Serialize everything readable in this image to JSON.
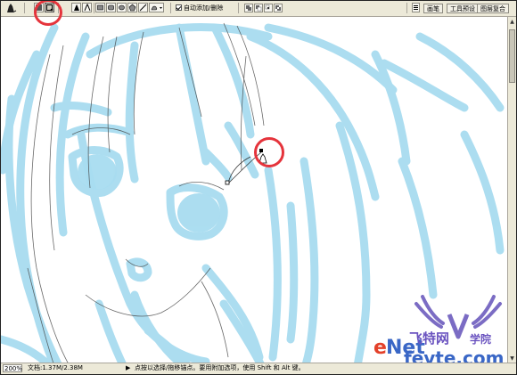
{
  "options_bar": {
    "auto_add_delete_label": "自动添加/删除",
    "auto_add_delete_checked": true,
    "palette_tabs": [
      "画笔",
      "工具预设",
      "图层复合"
    ]
  },
  "status_bar": {
    "zoom": "200%",
    "doc_info": "文档:1.37M/2.38M",
    "hint": "点按以选择/拖移锚点。要用附加选项，使用 Shift 和 Alt 键。"
  },
  "watermark": {
    "site_chinese": "飞特网",
    "site_chinese_suffix": "学院",
    "domain": "fevte.com",
    "brand_letters": "eNet"
  },
  "colors": {
    "sketch_blue": "#a8dcf0",
    "highlight_red": "#e5343c",
    "ui_gray": "#ece9d8"
  },
  "icons": {
    "pen_tool": "pen-icon",
    "shape_layers": "shape-layers-icon",
    "paths": "paths-icon",
    "rectangle": "rectangle-icon",
    "ellipse": "ellipse-icon"
  }
}
